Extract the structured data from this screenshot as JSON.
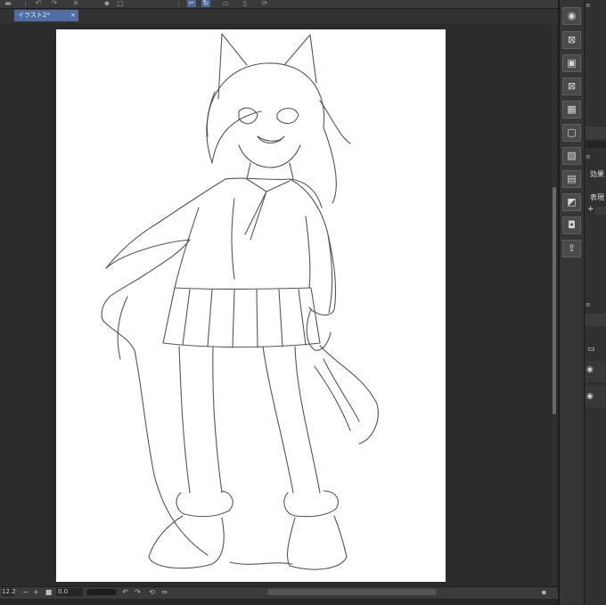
{
  "app": {
    "document_tab": "イラスト2*",
    "tab_close": "×"
  },
  "toolbar": {
    "icons": [
      "menu-icon",
      "undo-icon",
      "redo-icon",
      "spinner-icon",
      "fill-icon",
      "transform-icon",
      "snap-icon",
      "ruler-icon",
      "rotate-icon"
    ]
  },
  "status": {
    "zoom": "12.2",
    "zoom_minus": "−",
    "zoom_plus": "+",
    "angle": "0.0",
    "rotate_left": "↶",
    "rotate_right": "↷",
    "reset": "⟲",
    "flip": "⇔"
  },
  "right_icon_column": {
    "items": [
      {
        "name": "navigator-icon",
        "glyph": "◉"
      },
      {
        "name": "close-doc-icon",
        "glyph": "⊠"
      },
      {
        "name": "save-icon",
        "glyph": "▣"
      },
      {
        "name": "delete-icon",
        "glyph": "⊠"
      },
      {
        "name": "grid-icon",
        "glyph": "▦"
      },
      {
        "name": "comment-icon",
        "glyph": "▢"
      },
      {
        "name": "image-icon",
        "glyph": "▨"
      },
      {
        "name": "folder-icon",
        "glyph": "▤"
      },
      {
        "name": "edit-icon",
        "glyph": "◩"
      },
      {
        "name": "camera-icon",
        "glyph": "◘"
      },
      {
        "name": "export-icon",
        "glyph": "⇪"
      }
    ]
  },
  "panel": {
    "effect_label": "効果",
    "expression_label": "表現",
    "add_symbol": "+"
  }
}
